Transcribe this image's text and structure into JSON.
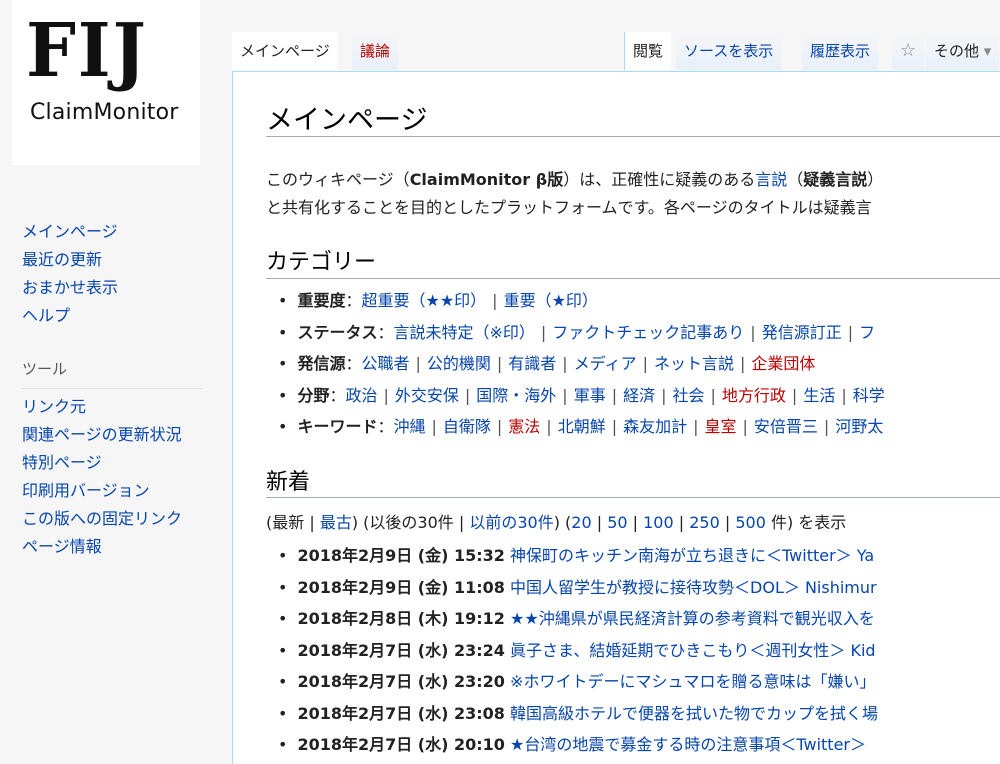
{
  "logo": {
    "big": "FIJ",
    "small": "ClaimMonitor"
  },
  "nav": {
    "items": [
      "メインページ",
      "最近の更新",
      "おまかせ表示",
      "ヘルプ"
    ],
    "tools_heading": "ツール",
    "tools": [
      "リンク元",
      "関連ページの更新状況",
      "特別ページ",
      "印刷用バージョン",
      "この版への固定リンク",
      "ページ情報"
    ]
  },
  "tabs": {
    "main": "メインページ",
    "talk": "議論",
    "read": "閲覧",
    "view_source": "ソースを表示",
    "history": "履歴表示",
    "more": "その他"
  },
  "page": {
    "title": "メインページ",
    "intro": {
      "l1_a": "このウィキページ（",
      "l1_b": "ClaimMonitor β版",
      "l1_c": "）は、正確性に疑義のある",
      "l1_d": "言説",
      "l1_e": "（",
      "l1_f": "疑義言説",
      "l1_g": "）",
      "l2": "と共有化することを目的としたプラットフォームです。各ページのタイトルは疑義言"
    },
    "category_heading": "カテゴリー",
    "categories": [
      {
        "label": "重要度",
        "links": [
          {
            "t": "超重要（★★印）",
            "red": false
          },
          {
            "t": "重要（★印）",
            "red": false
          }
        ]
      },
      {
        "label": "ステータス",
        "links": [
          {
            "t": "言説未特定（※印）",
            "red": false
          },
          {
            "t": "ファクトチェック記事あり",
            "red": false
          },
          {
            "t": "発信源訂正",
            "red": false
          },
          {
            "t": "フ",
            "red": false
          }
        ]
      },
      {
        "label": "発信源",
        "links": [
          {
            "t": "公職者",
            "red": false
          },
          {
            "t": "公的機関",
            "red": false
          },
          {
            "t": "有識者",
            "red": false
          },
          {
            "t": "メディア",
            "red": false
          },
          {
            "t": "ネット言説",
            "red": false
          },
          {
            "t": "企業団体",
            "red": true
          }
        ]
      },
      {
        "label": "分野",
        "links": [
          {
            "t": "政治",
            "red": false
          },
          {
            "t": "外交安保",
            "red": false
          },
          {
            "t": "国際・海外",
            "red": false
          },
          {
            "t": "軍事",
            "red": false
          },
          {
            "t": "経済",
            "red": false
          },
          {
            "t": "社会",
            "red": false
          },
          {
            "t": "地方行政",
            "red": true
          },
          {
            "t": "生活",
            "red": false
          },
          {
            "t": "科学",
            "red": false
          }
        ]
      },
      {
        "label": "キーワード",
        "links": [
          {
            "t": "沖縄",
            "red": false
          },
          {
            "t": "自衛隊",
            "red": false
          },
          {
            "t": "憲法",
            "red": true
          },
          {
            "t": "北朝鮮",
            "red": false
          },
          {
            "t": "森友加計",
            "red": false
          },
          {
            "t": "皇室",
            "red": true
          },
          {
            "t": "安倍晋三",
            "red": false
          },
          {
            "t": "河野太",
            "red": false
          }
        ]
      }
    ],
    "new_heading": "新着",
    "new_nav": {
      "open": "(最新 | ",
      "oldest": "最古",
      "mid1": ") (以後の30件 | ",
      "prev": "以前の30件",
      "mid2": ") (",
      "n20": "20",
      "n50": "50",
      "n100": "100",
      "n250": "250",
      "n500": "500",
      "end": " 件) を表示"
    },
    "new_items": [
      {
        "date": "2018年2月9日 (金) 15:32",
        "title": "神保町のキッチン南海が立ち退きに＜Twitter＞ Ya"
      },
      {
        "date": "2018年2月9日 (金) 11:08",
        "title": "中国人留学生が教授に接待攻勢＜DOL＞ Nishimur"
      },
      {
        "date": "2018年2月8日 (木) 19:12",
        "title": "★★沖縄県が県民経済計算の参考資料で観光収入を"
      },
      {
        "date": "2018年2月7日 (水) 23:24",
        "title": "眞子さま、結婚延期でひきこもり＜週刊女性＞ Kid"
      },
      {
        "date": "2018年2月7日 (水) 23:20",
        "title": "※ホワイトデーにマシュマロを贈る意味は「嫌い」"
      },
      {
        "date": "2018年2月7日 (水) 23:08",
        "title": "韓国高級ホテルで便器を拭いた物でカップを拭く場"
      },
      {
        "date": "2018年2月7日 (水) 20:10",
        "title": "★台湾の地震で募金する時の注意事項＜Twitter＞"
      }
    ]
  }
}
